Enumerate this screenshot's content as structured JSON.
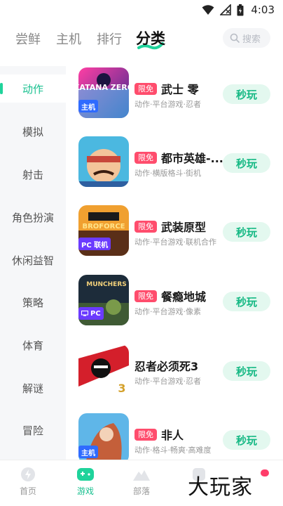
{
  "status_bar": {
    "time": "4:03"
  },
  "top_tabs": [
    "尝鲜",
    "主机",
    "排行",
    "分类"
  ],
  "search": {
    "placeholder": "搜索"
  },
  "sidebar": {
    "items": [
      {
        "label": "动作"
      },
      {
        "label": "模拟"
      },
      {
        "label": "射击"
      },
      {
        "label": "角色扮演"
      },
      {
        "label": "休闲益智"
      },
      {
        "label": "策略"
      },
      {
        "label": "体育"
      },
      {
        "label": "解谜"
      },
      {
        "label": "冒险"
      }
    ],
    "active": "动作"
  },
  "games": [
    {
      "badge": "限免",
      "name": "武士 零",
      "desc": "动作·平台游戏·忍者",
      "play": "秒玩",
      "chip": "主机",
      "chip_color": "#2f6bff",
      "cover_title": "KATANA ZERO",
      "cover_colors": [
        "#3b2b8f",
        "#ff3fa4"
      ]
    },
    {
      "badge": "限免",
      "name": "都市英雄-...",
      "desc": "动作·横版格斗·街机",
      "play": "秒玩",
      "chip": "",
      "chip_color": "",
      "cover_title": "",
      "cover_colors": [
        "#4bb8e0",
        "#c8463a"
      ]
    },
    {
      "badge": "限免",
      "name": "武装原型",
      "desc": "动作·平台游戏·联机合作",
      "play": "秒玩",
      "chip": "PC 联机",
      "chip_color": "#6b3bff",
      "cover_title": "BROFORCE",
      "cover_colors": [
        "#f0a030",
        "#5a2f18"
      ]
    },
    {
      "badge": "限免",
      "name": "餐瘾地城",
      "desc": "动作·平台游戏·像素",
      "play": "秒玩",
      "chip": "PC",
      "chip_color": "#6b3bff",
      "cover_title": "MUNCHERS",
      "cover_colors": [
        "#1d2c3a",
        "#7a9a4a"
      ]
    },
    {
      "badge": "",
      "name": "忍者必须死3",
      "desc": "动作·平台游戏·忍者",
      "play": "秒玩",
      "chip": "",
      "chip_color": "",
      "cover_title": "3",
      "cover_colors": [
        "#d41f2b",
        "#111111"
      ]
    },
    {
      "badge": "限免",
      "name": "非人",
      "desc": "动作·格斗·畅爽·高难度",
      "play": "秒玩",
      "chip": "主机",
      "chip_color": "#2f6bff",
      "cover_title": "",
      "cover_colors": [
        "#5fb6e8",
        "#c45f3a"
      ]
    }
  ],
  "bottom_nav": [
    {
      "label": "首页",
      "icon": "home-icon"
    },
    {
      "label": "游戏",
      "icon": "gamepad-icon"
    },
    {
      "label": "部落",
      "icon": "mountain-icon"
    },
    {
      "label": "",
      "icon": "profile-icon"
    }
  ],
  "watermark": "大玩家",
  "colors": {
    "accent": "#18c08f",
    "badge": "#ff4d6d",
    "play_bg": "#e3f8ef"
  }
}
